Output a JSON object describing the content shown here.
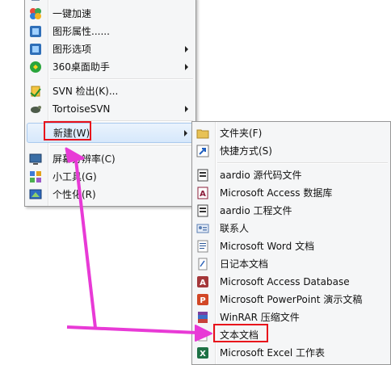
{
  "context_menu": {
    "items": [
      {
        "label": "一键加速",
        "icon": "speed-up-icon"
      },
      {
        "label": "图形属性......",
        "icon": "graphics-properties-icon"
      },
      {
        "label": "图形选项",
        "icon": "graphics-options-icon"
      },
      {
        "label": "360桌面助手",
        "icon": "360-desktop-icon"
      },
      {
        "label": "SVN 检出(K)...",
        "icon": "svn-checkout-icon"
      },
      {
        "label": "TortoiseSVN",
        "icon": "tortoise-svn-icon"
      },
      {
        "label": "新建(W)"
      },
      {
        "label": "屏幕分辨率(C)",
        "icon": "screen-resolution-icon"
      },
      {
        "label": "小工具(G)",
        "icon": "gadgets-icon"
      },
      {
        "label": "个性化(R)",
        "icon": "personalize-icon"
      }
    ]
  },
  "new_submenu": {
    "items": [
      {
        "label": "文件夹(F)",
        "icon": "folder-icon"
      },
      {
        "label": "快捷方式(S)",
        "icon": "shortcut-icon"
      },
      {
        "label": "aardio 源代码文件",
        "icon": "aardio-source-icon"
      },
      {
        "label": "Microsoft Access 数据库",
        "icon": "access-icon"
      },
      {
        "label": "aardio 工程文件",
        "icon": "aardio-project-icon"
      },
      {
        "label": "联系人",
        "icon": "contact-icon"
      },
      {
        "label": "Microsoft Word 文档",
        "icon": "word-icon"
      },
      {
        "label": "日记本文档",
        "icon": "journal-icon"
      },
      {
        "label": "Microsoft Access Database",
        "icon": "access-db-icon"
      },
      {
        "label": "Microsoft PowerPoint 演示文稿",
        "icon": "powerpoint-icon"
      },
      {
        "label": "WinRAR 压缩文件",
        "icon": "winrar-icon"
      },
      {
        "label": "文本文档",
        "icon": "text-document-icon"
      },
      {
        "label": "Microsoft Excel 工作表",
        "icon": "excel-icon"
      }
    ]
  },
  "colors": {
    "annotation_red": "#e8111b",
    "annotation_magenta": "#e83ad6"
  }
}
